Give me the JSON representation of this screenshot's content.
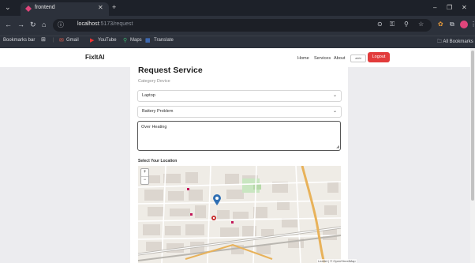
{
  "browser": {
    "tab_title": "frontend",
    "url_host": "localhost",
    "url_path": ":5173/request",
    "bookmarks_label": "Bookmarks bar",
    "bookmarks": [
      "Gmail",
      "YouTube",
      "Maps",
      "Translate"
    ],
    "all_bookmarks": "All Bookmarks"
  },
  "navbar": {
    "brand": "FixItAI",
    "links": [
      "Home",
      "Services",
      "About"
    ],
    "user": "abhi",
    "logout": "Logout"
  },
  "form": {
    "title": "Request Service",
    "subtitle": "Category Device",
    "device_value": "Laptop",
    "problem_value": "Battery Problem",
    "description_value": "Over Heating",
    "location_label": "Select Your Location"
  },
  "map": {
    "zoom_in": "+",
    "zoom_out": "−",
    "attribution": "Leaflet | © OpenStreetMap"
  },
  "colors": {
    "logout": "#e23b3b",
    "marker": "#2f6fb3",
    "road_major": "#e8b25a"
  }
}
